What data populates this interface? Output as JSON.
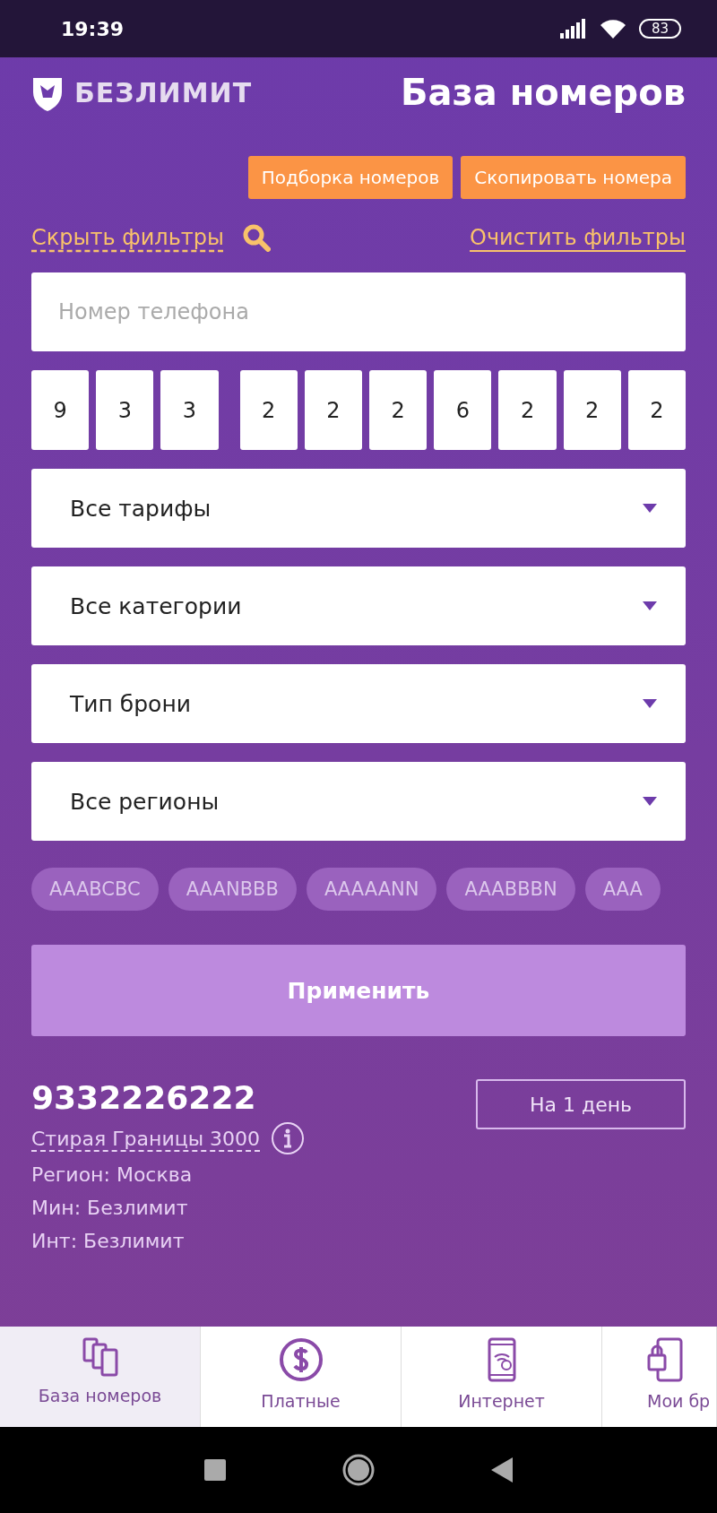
{
  "status_bar": {
    "time": "19:39",
    "battery": "83"
  },
  "header": {
    "logo_text": "БЕЗЛИМИТ",
    "title": "База номеров"
  },
  "actions": [
    {
      "label": "Подборка номеров"
    },
    {
      "label": "Скопировать номера"
    }
  ],
  "filter_links": {
    "hide": "Скрыть фильтры",
    "clear": "Очистить фильтры"
  },
  "phone_field": {
    "placeholder": "Номер телефона"
  },
  "digits": [
    {
      "value": "9"
    },
    {
      "value": "3"
    },
    {
      "value": "3"
    },
    {
      "value": "2"
    },
    {
      "value": "2"
    },
    {
      "value": "2"
    },
    {
      "value": "6"
    },
    {
      "value": "2"
    },
    {
      "value": "2"
    },
    {
      "value": "2"
    }
  ],
  "dropdowns": [
    {
      "value": "Все тарифы"
    },
    {
      "value": "Все категории"
    },
    {
      "value": "Тип брони"
    },
    {
      "value": "Все регионы"
    }
  ],
  "patterns": [
    {
      "label": "AAABCBC",
      "selected": false
    },
    {
      "label": "AAANBBB",
      "selected": false
    },
    {
      "label": "AAAAANN",
      "selected": false
    },
    {
      "label": "AAABBBN",
      "selected": false
    },
    {
      "label": "AAA",
      "selected": false
    }
  ],
  "apply_button": {
    "label": "Применить",
    "disabled": true
  },
  "result": {
    "number": "9332226222",
    "tariff": "Стирая Границы 3000",
    "lines": [
      "Регион: Москва",
      "Мин: Безлимит",
      "Инт: Безлимит"
    ],
    "reserve_button": "На 1 день"
  },
  "bottom_nav": [
    {
      "label": "База номеров",
      "selected": true
    },
    {
      "label": "Платные",
      "selected": false
    },
    {
      "label": "Интернет",
      "selected": false
    },
    {
      "label": "Мои бр",
      "selected": false
    }
  ]
}
